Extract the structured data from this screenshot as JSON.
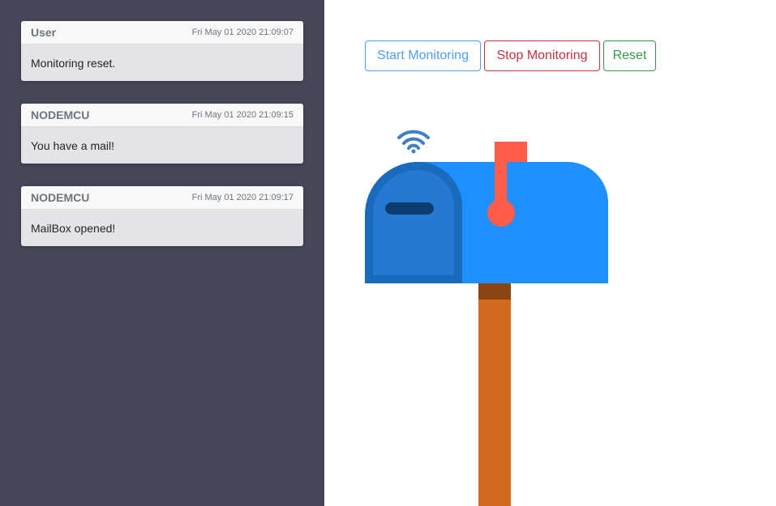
{
  "notifications": [
    {
      "sender": "User",
      "time": "Fri May 01 2020 21:09:07",
      "message": "Monitoring reset."
    },
    {
      "sender": "NODEMCU",
      "time": "Fri May 01 2020 21:09:15",
      "message": "You have a mail!"
    },
    {
      "sender": "NODEMCU",
      "time": "Fri May 01 2020 21:09:17",
      "message": "MailBox opened!"
    }
  ],
  "controls": {
    "start_label": "Start Monitoring",
    "stop_label": "Stop Monitoring",
    "reset_label": "Reset"
  },
  "mailbox": {
    "icons": [
      "wifi-icon",
      "mailbox-icon",
      "flag-icon"
    ],
    "colors": {
      "sidebar": "#454759",
      "box": "#1e90ff",
      "door": "#2579d2",
      "flag": "#ff5c4a",
      "post": "#d2691e"
    }
  }
}
